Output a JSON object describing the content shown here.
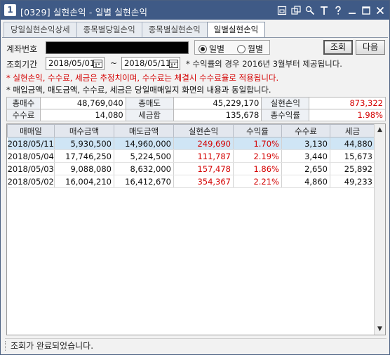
{
  "window": {
    "screen_number": "1",
    "title": "[0329] 실현손익 - 일별 실현손익"
  },
  "titlebar_icons": [
    "window-link-icon",
    "window-copy-icon",
    "settings-icon",
    "text-size-icon",
    "help-icon",
    "minimize-icon",
    "maximize-icon",
    "close-icon"
  ],
  "tabs": [
    {
      "label": "당일실현손익상세"
    },
    {
      "label": "종목별당일손익"
    },
    {
      "label": "종목별실현손익"
    },
    {
      "label": "일별실현손익",
      "active": true
    }
  ],
  "form": {
    "account_label": "계좌번호",
    "radio_daily": "일별",
    "radio_monthly": "월별",
    "selected_radio": "일별",
    "query_button": "조회",
    "next_button": "다음",
    "period_label": "조회기간",
    "start_date": "2018/05/01",
    "tilde": "~",
    "end_date": "2018/05/11",
    "period_note": "* 수익률의 경우 2016년 3월부터 제공됩니다."
  },
  "notices": {
    "line1": "* 실현손익, 수수료, 세금은 추정치이며, 수수료는 체결시 수수료율로 적용됩니다.",
    "line2": "* 매입금액, 매도금액, 수수료, 세금은 당일매매일지 화면의 내용과 동일합니다."
  },
  "summary": {
    "total_buy_label": "총매수",
    "total_buy": "48,769,040",
    "total_sell_label": "총매도",
    "total_sell": "45,229,170",
    "realized_pl_label": "실현손익",
    "realized_pl": "873,322",
    "fee_label": "수수료",
    "fee": "14,080",
    "tax_label": "세금합",
    "tax": "135,678",
    "total_return_label": "총수익률",
    "total_return": "1.98%"
  },
  "grid": {
    "columns": [
      "매매일",
      "매수금액",
      "매도금액",
      "실현손익",
      "수익률",
      "수수료",
      "세금"
    ],
    "rows": [
      {
        "date": "2018/05/11",
        "buy": "5,930,500",
        "sell": "14,960,000",
        "pl": "249,690",
        "rate": "1.70%",
        "fee": "3,130",
        "tax": "44,880"
      },
      {
        "date": "2018/05/04",
        "buy": "17,746,250",
        "sell": "5,224,500",
        "pl": "111,787",
        "rate": "2.19%",
        "fee": "3,440",
        "tax": "15,673"
      },
      {
        "date": "2018/05/03",
        "buy": "9,088,080",
        "sell": "8,632,000",
        "pl": "157,478",
        "rate": "1.86%",
        "fee": "2,650",
        "tax": "25,892"
      },
      {
        "date": "2018/05/02",
        "buy": "16,004,210",
        "sell": "16,412,670",
        "pl": "354,367",
        "rate": "2.21%",
        "fee": "4,860",
        "tax": "49,233"
      }
    ]
  },
  "status": {
    "message": "조회가 완료되었습니다."
  },
  "colors": {
    "titlebar": "#3f5a86",
    "profit_red": "#d40000",
    "selected_row": "#cfe5f5"
  }
}
